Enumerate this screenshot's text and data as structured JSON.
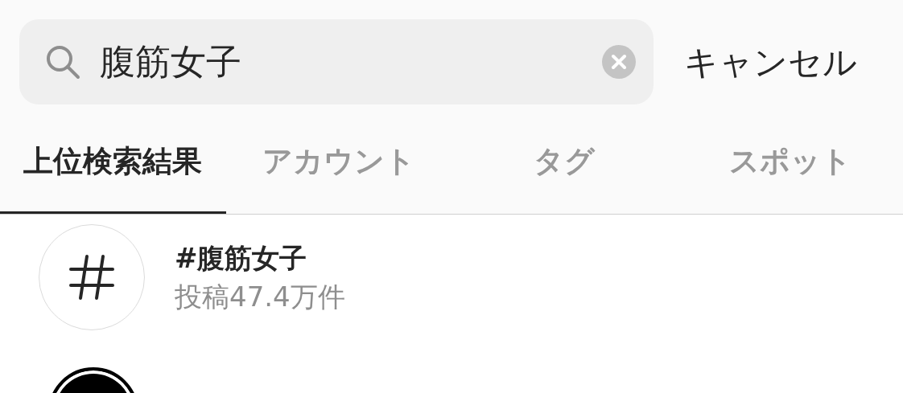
{
  "search": {
    "value": "腹筋女子"
  },
  "cancel": "キャンセル",
  "tabs": [
    {
      "label": "上位検索結果",
      "selected": true
    },
    {
      "label": "アカウント",
      "selected": false
    },
    {
      "label": "タグ",
      "selected": false
    },
    {
      "label": "スポット",
      "selected": false
    }
  ],
  "results": [
    {
      "kind": "hashtag",
      "title": "#腹筋女子",
      "subtitle": "投稿47.4万件"
    },
    {
      "kind": "avatar"
    }
  ]
}
